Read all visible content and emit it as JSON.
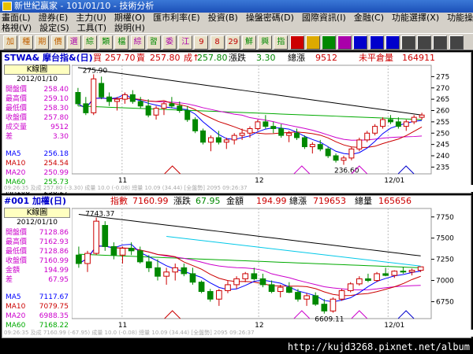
{
  "window": {
    "title": "新世紀贏家 - 101/01/10 - 技術分析"
  },
  "menu": {
    "row1": [
      "畫面(L)",
      "證券(E)",
      "主力(U)",
      "期權(O)",
      "匯市利率(E)",
      "投資(B)",
      "操盤密碼(D)",
      "國際資訊(I)",
      "金融(C)",
      "功能選擇(X)",
      "功能操作(C)"
    ],
    "row2": [
      "格視(V)",
      "設定(S)",
      "工具(T)",
      "說明(H)"
    ]
  },
  "toolbar": {
    "buttons": [
      "加",
      "種",
      "期",
      "價",
      "選",
      "綜",
      "類",
      "檔",
      "綜",
      "習",
      "委",
      "江",
      "9",
      "8",
      "29",
      "鮮",
      "興",
      "指",
      "",
      "",
      "",
      "",
      "",
      "",
      "",
      "",
      "",
      "",
      ""
    ]
  },
  "panel1": {
    "header": {
      "symbol": "STWA& 摩台指&(日)",
      "buy_label": "買",
      "buy": "257.70",
      "sell_label": "賣",
      "sell": "257.80",
      "deal_label": "成↑",
      "deal": "257.80",
      "change_label": "漲跌",
      "change": "3.30",
      "vol_label": "總漲",
      "vol": "9512",
      "oi_label": "未平倉量",
      "oi": "164911"
    },
    "sidebar": {
      "title": "K線圖",
      "date": "2012/01/10",
      "rows": [
        {
          "label": "開盤價",
          "value": "258.40",
          "color": "#cc00cc"
        },
        {
          "label": "最高價",
          "value": "259.10",
          "color": "#cc00cc"
        },
        {
          "label": "最低價",
          "value": "258.30",
          "color": "#cc00cc"
        },
        {
          "label": "收盤價",
          "value": "257.80",
          "color": "#cc00cc"
        },
        {
          "label": "成交量",
          "value": "9512",
          "color": "#cc00cc"
        },
        {
          "label": "差",
          "value": "3.30",
          "color": "#cc00cc"
        }
      ],
      "ma": [
        {
          "label": "MA5",
          "value": "256.18",
          "color": "#0000ff"
        },
        {
          "label": "MA10",
          "value": "254.54",
          "color": "#cc0000"
        },
        {
          "label": "MA20",
          "value": "250.99",
          "color": "#cc00cc"
        },
        {
          "label": "MA60",
          "value": "255.73",
          "color": "#00aa00"
        },
        {
          "label": "MA108",
          "value": "258.27",
          "color": "#000000"
        }
      ]
    },
    "high_label": "275.90",
    "low_label": "236.60",
    "status": "09:26:35 及成 257.80 (-3.30) 成量 10.0 (-0.08) 總量 10.09 (34.44) [全盤勢]  2095  09:26:37"
  },
  "panel2": {
    "header": {
      "symbol": "#001 加權(日)",
      "index_label": "指數",
      "index": "7160.99",
      "change_label": "漲跌",
      "change": "67.95",
      "amount_label": "金額",
      "amount": "194.99",
      "vol_label": "總漲",
      "vol": "719653",
      "vol2_label": "總量",
      "vol2": "165656"
    },
    "sidebar": {
      "title": "K線圖",
      "date": "2012/01/10",
      "rows": [
        {
          "label": "開盤價",
          "value": "7128.86",
          "color": "#cc00cc"
        },
        {
          "label": "最高價",
          "value": "7162.93",
          "color": "#cc00cc"
        },
        {
          "label": "最低價",
          "value": "7128.86",
          "color": "#cc00cc"
        },
        {
          "label": "收盤價",
          "value": "7160.99",
          "color": "#cc00cc"
        },
        {
          "label": "金額",
          "value": "194.99",
          "color": "#cc00cc"
        },
        {
          "label": "差",
          "value": "67.95",
          "color": "#cc00cc"
        }
      ],
      "ma": [
        {
          "label": "MA5",
          "value": "7117.67",
          "color": "#0000ff"
        },
        {
          "label": "MA10",
          "value": "7079.75",
          "color": "#cc0000"
        },
        {
          "label": "MA20",
          "value": "6988.35",
          "color": "#cc00cc"
        },
        {
          "label": "MA60",
          "value": "7168.22",
          "color": "#00aa00"
        },
        {
          "label": "MA108",
          "value": "7282.87",
          "color": "#000000"
        }
      ]
    },
    "high_label": "7743.37",
    "low_label": "6609.11",
    "status": "09:26:35 及成 7160.99 (-67.95) 成量 10.0 (-0.08) 總量 10.09 (34.44) [全盤勢]  2095  09:26:37"
  },
  "footer": {
    "url": "http://kujd3268.pixnet.net/album"
  },
  "chart_data": [
    {
      "type": "candlestick",
      "title": "STWA& 摩台指&(日)",
      "x_labels": [
        "11",
        "12",
        "12/01"
      ],
      "ylim": [
        232,
        280
      ],
      "y_ticks": [
        235,
        240,
        245,
        250,
        255,
        260,
        265,
        270,
        275
      ],
      "candles": [
        [
          268,
          270,
          262,
          263
        ],
        [
          263,
          266,
          258,
          259
        ],
        [
          259,
          276,
          258,
          274
        ],
        [
          272,
          275,
          265,
          266
        ],
        [
          266,
          268,
          262,
          264
        ],
        [
          264,
          266,
          260,
          265
        ],
        [
          265,
          268,
          263,
          267
        ],
        [
          267,
          269,
          263,
          264
        ],
        [
          264,
          266,
          261,
          262
        ],
        [
          262,
          265,
          257,
          258
        ],
        [
          258,
          262,
          256,
          261
        ],
        [
          261,
          264,
          258,
          263
        ],
        [
          263,
          266,
          261,
          262
        ],
        [
          262,
          264,
          259,
          260
        ],
        [
          260,
          262,
          255,
          256
        ],
        [
          256,
          257,
          250,
          251
        ],
        [
          251,
          252,
          245,
          246
        ],
        [
          246,
          249,
          242,
          248
        ],
        [
          248,
          251,
          245,
          246
        ],
        [
          246,
          248,
          243,
          247
        ],
        [
          247,
          250,
          245,
          249
        ],
        [
          249,
          252,
          247,
          250
        ],
        [
          250,
          253,
          248,
          252
        ],
        [
          252,
          256,
          251,
          255
        ],
        [
          255,
          258,
          252,
          253
        ],
        [
          253,
          255,
          250,
          252
        ],
        [
          252,
          254,
          248,
          249
        ],
        [
          249,
          251,
          246,
          250
        ],
        [
          250,
          252,
          247,
          248
        ],
        [
          248,
          249,
          243,
          244
        ],
        [
          244,
          246,
          241,
          245
        ],
        [
          245,
          247,
          242,
          243
        ],
        [
          243,
          244,
          239,
          240
        ],
        [
          240,
          241,
          237,
          238
        ],
        [
          238,
          240,
          236,
          239
        ],
        [
          239,
          244,
          238,
          243
        ],
        [
          243,
          248,
          242,
          247
        ],
        [
          247,
          251,
          246,
          250
        ],
        [
          250,
          254,
          249,
          253
        ],
        [
          253,
          257,
          252,
          256
        ],
        [
          256,
          258,
          254,
          255
        ],
        [
          255,
          257,
          252,
          253
        ],
        [
          253,
          256,
          251,
          255
        ],
        [
          255,
          258,
          254,
          257
        ],
        [
          257,
          259,
          256,
          258
        ]
      ]
    },
    {
      "type": "candlestick",
      "title": "#001 加權(日)",
      "x_labels": [
        "11",
        "12",
        "12/01"
      ],
      "ylim": [
        6550,
        7850
      ],
      "y_ticks": [
        6500,
        6750,
        7000,
        7250,
        7500,
        7750
      ],
      "candles": [
        [
          7300,
          7400,
          7150,
          7200
        ],
        [
          7200,
          7350,
          7100,
          7320
        ],
        [
          7320,
          7743,
          7300,
          7700
        ],
        [
          7650,
          7700,
          7350,
          7400
        ],
        [
          7400,
          7450,
          7250,
          7300
        ],
        [
          7300,
          7400,
          7200,
          7380
        ],
        [
          7380,
          7450,
          7300,
          7350
        ],
        [
          7350,
          7400,
          7200,
          7220
        ],
        [
          7220,
          7300,
          7100,
          7150
        ],
        [
          7150,
          7250,
          7000,
          7050
        ],
        [
          7050,
          7150,
          6950,
          7100
        ],
        [
          7100,
          7200,
          7000,
          7150
        ],
        [
          7150,
          7200,
          7050,
          7080
        ],
        [
          7080,
          7150,
          6950,
          6980
        ],
        [
          6980,
          7000,
          6850,
          6870
        ],
        [
          6870,
          6900,
          6750,
          6780
        ],
        [
          6780,
          6900,
          6700,
          6880
        ],
        [
          6880,
          7000,
          6850,
          6950
        ],
        [
          6950,
          7050,
          6900,
          7020
        ],
        [
          7020,
          7100,
          6980,
          7080
        ],
        [
          7080,
          7150,
          7000,
          7020
        ],
        [
          7020,
          7080,
          6920,
          6950
        ],
        [
          6950,
          7000,
          6850,
          6870
        ],
        [
          6870,
          6950,
          6800,
          6920
        ],
        [
          6920,
          6980,
          6850,
          6860
        ],
        [
          6860,
          6900,
          6750,
          6780
        ],
        [
          6780,
          6850,
          6700,
          6820
        ],
        [
          6820,
          6860,
          6700,
          6720
        ],
        [
          6720,
          6780,
          6609,
          6640
        ],
        [
          6640,
          6800,
          6620,
          6780
        ],
        [
          6780,
          6900,
          6760,
          6880
        ],
        [
          6880,
          6980,
          6860,
          6960
        ],
        [
          6960,
          7050,
          6940,
          7020
        ],
        [
          7020,
          7080,
          6980,
          7000
        ],
        [
          7000,
          7100,
          6980,
          7080
        ],
        [
          7080,
          7150,
          7050,
          7060
        ],
        [
          7060,
          7120,
          7030,
          7110
        ],
        [
          7110,
          7160,
          7080,
          7100
        ],
        [
          7100,
          7140,
          7060,
          7120
        ],
        [
          7120,
          7163,
          7100,
          7161
        ]
      ]
    }
  ]
}
